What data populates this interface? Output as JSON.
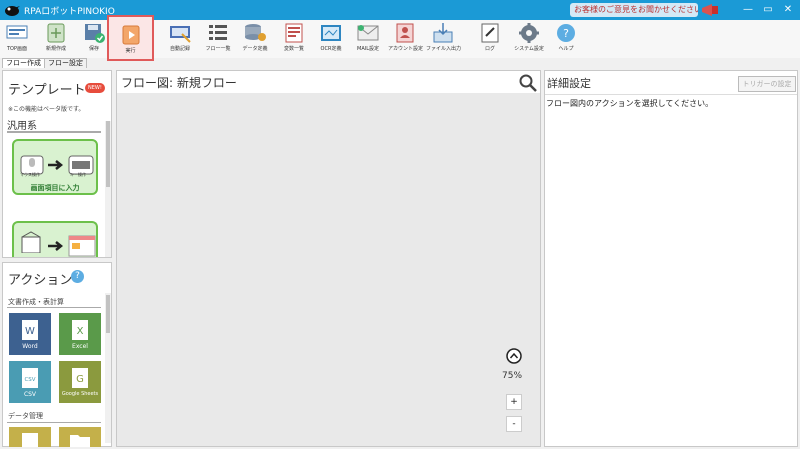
{
  "window": {
    "title": "RPAロボットPINOKIO",
    "feedback_label": "お客様のご意見をお聞かせください",
    "minimize": "—",
    "restore": "▭",
    "close": "✕"
  },
  "toolbar": {
    "items": [
      {
        "label": "TOP画面",
        "icon": "top-screen-icon"
      },
      {
        "label": "新規作成",
        "icon": "new-file-icon"
      },
      {
        "label": "保存",
        "icon": "save-icon"
      },
      {
        "label": "実行",
        "icon": "run-icon"
      },
      {
        "label": "自動記録",
        "icon": "auto-record-icon"
      },
      {
        "label": "フロー一覧",
        "icon": "flow-list-icon"
      },
      {
        "label": "データ定義",
        "icon": "data-definition-icon"
      },
      {
        "label": "変数一覧",
        "icon": "variable-list-icon"
      },
      {
        "label": "OCR定義",
        "icon": "ocr-icon"
      },
      {
        "label": "MAIL設定",
        "icon": "mail-icon"
      },
      {
        "label": "アカウント設定",
        "icon": "account-icon"
      },
      {
        "label": "ファイル入出力",
        "icon": "file-io-icon"
      },
      {
        "label": "ログ",
        "icon": "log-icon"
      },
      {
        "label": "システム設定",
        "icon": "gear-icon"
      },
      {
        "label": "ヘルプ",
        "icon": "help-icon"
      }
    ]
  },
  "tabs": [
    {
      "label": "フロー作成"
    },
    {
      "label": "フロー設定"
    }
  ],
  "templates": {
    "heading": "テンプレート",
    "new_badge": "NEW!",
    "note": "※この機能はベータ版です。",
    "category": "汎用系",
    "card1": {
      "label": "画面項目に入力",
      "left_caption": "マウス操作",
      "right_caption": "キー操作"
    }
  },
  "actions": {
    "heading": "アクション",
    "help": "?",
    "section1": "文書作成・表計算",
    "tiles": [
      {
        "label": "Word",
        "glyph": "W",
        "color": "#3d6190"
      },
      {
        "label": "Excel",
        "glyph": "X",
        "color": "#5a9a4a"
      },
      {
        "label": "CSV",
        "glyph": "CSV",
        "color": "#4a9cb3"
      },
      {
        "label": "Google Sheets",
        "glyph": "G",
        "color": "#8b9a3e"
      }
    ],
    "section2": "データ管理"
  },
  "flow": {
    "title": "フロー図:  新規フロー",
    "zoom": "75%",
    "zoom_in": "+",
    "zoom_out": "-"
  },
  "details": {
    "title": "詳細設定",
    "trigger_button": "トリガーの設定",
    "hint": "フロー図内のアクションを選択してください。"
  }
}
